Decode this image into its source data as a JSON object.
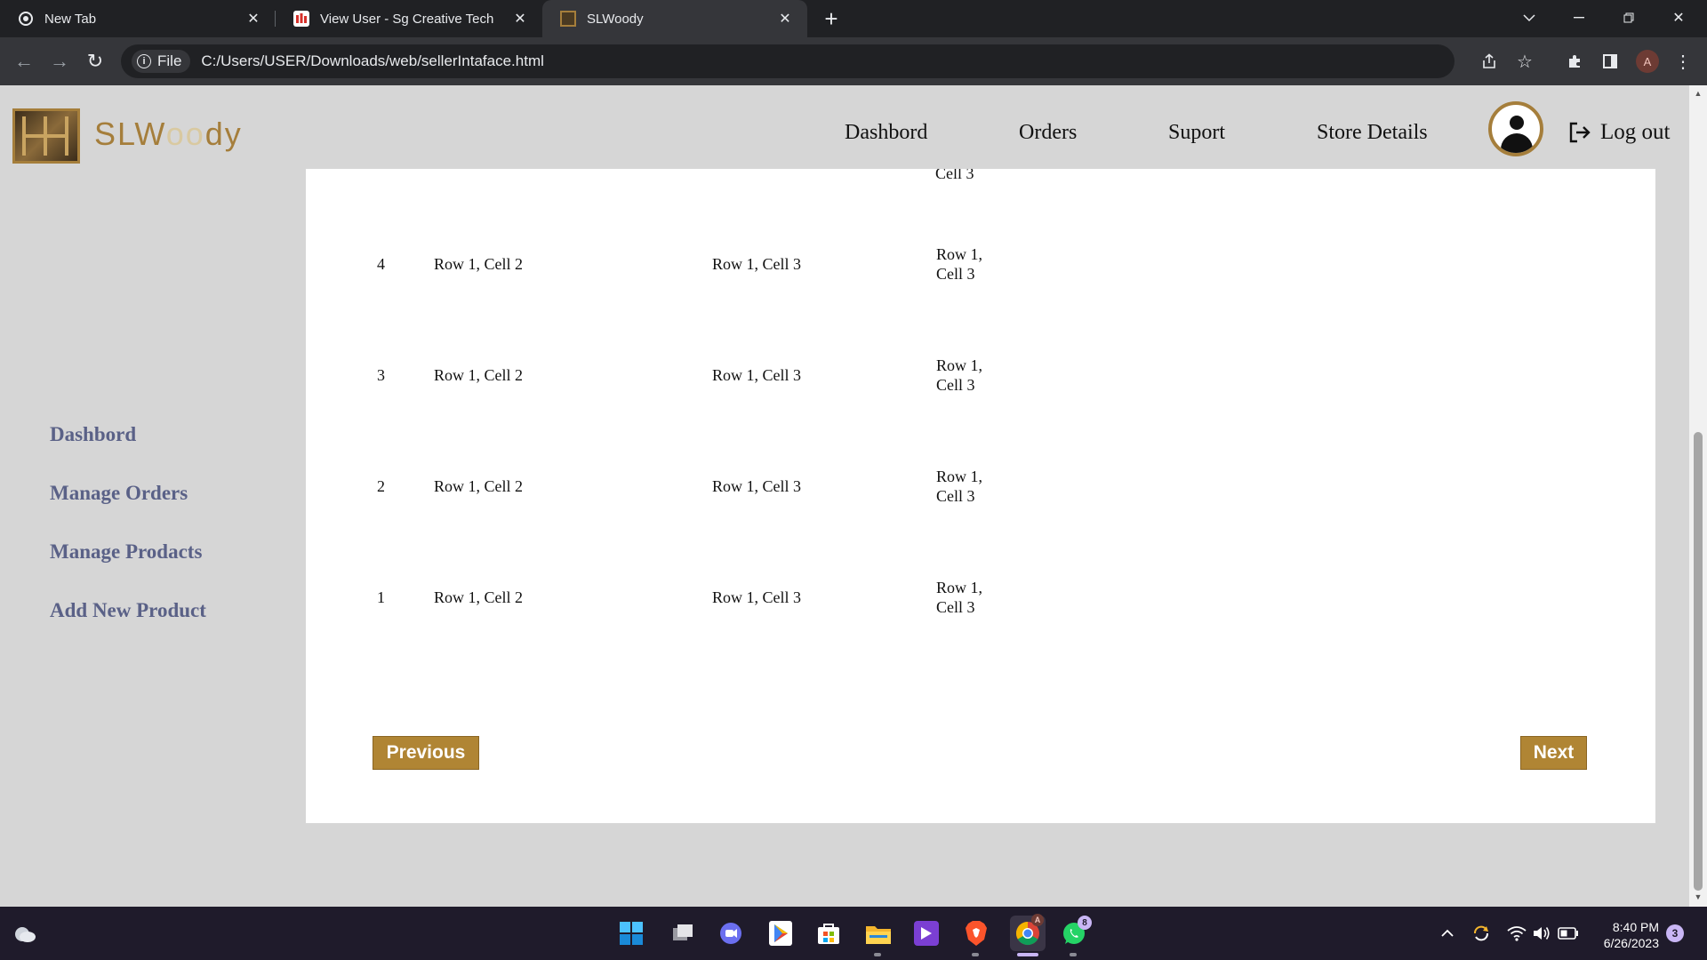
{
  "browser": {
    "tabs": [
      {
        "label": "New Tab",
        "icon": "chrome-icon"
      },
      {
        "label": "View User - Sg Creative Tech",
        "icon": "sg-creative-icon"
      },
      {
        "label": "SLWoody",
        "icon": "slwoody-favicon"
      }
    ],
    "active_tab": 2,
    "url_chip": "File",
    "url": "C:/Users/USER/Downloads/web/sellerIntaface.html",
    "profile_initial": "A"
  },
  "header": {
    "logo_primary": "SLW",
    "logo_faded": "oo",
    "logo_tail": "dy",
    "nav": [
      "Dashbord",
      "Orders",
      "Suport",
      "Store Details"
    ],
    "logout_label": "Log out"
  },
  "sidebar": {
    "items": [
      "Dashbord",
      "Manage Orders",
      "Manage Prodacts",
      "Add New Product"
    ]
  },
  "table": {
    "partial_cell": "Cell 3",
    "rows": [
      {
        "id": "4",
        "c2": "Row 1, Cell 2",
        "c3": "Row 1, Cell 3",
        "c4a": "Row 1,",
        "c4b": "Cell 3"
      },
      {
        "id": "3",
        "c2": "Row 1, Cell 2",
        "c3": "Row 1, Cell 3",
        "c4a": "Row 1,",
        "c4b": "Cell 3"
      },
      {
        "id": "2",
        "c2": "Row 1, Cell 2",
        "c3": "Row 1, Cell 3",
        "c4a": "Row 1,",
        "c4b": "Cell 3"
      },
      {
        "id": "1",
        "c2": "Row 1, Cell 2",
        "c3": "Row 1, Cell 3",
        "c4a": "Row 1,",
        "c4b": "Cell 3"
      }
    ]
  },
  "pagination": {
    "previous_label": "Previous",
    "next_label": "Next"
  },
  "taskbar": {
    "whatsapp_badge": "8",
    "chrome_badge": "A",
    "time": "8:40 PM",
    "date": "6/26/2023",
    "notification_count": "3"
  },
  "colors": {
    "accent": "#b08534",
    "sidebar_text": "#5a6187",
    "logo": "#a57e3b"
  }
}
